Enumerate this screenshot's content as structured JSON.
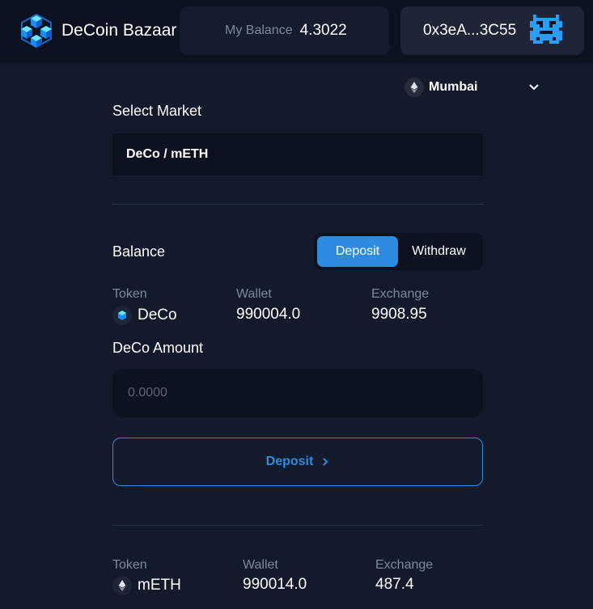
{
  "header": {
    "brand_name": "DeCoin Bazaar",
    "balance_label": "My Balance",
    "balance_value": "4.3022",
    "account_address": "0x3eA...3C55",
    "logo_icon": "hexagon-cubes-logo",
    "avatar_icon": "pixel-avatar-icon"
  },
  "network": {
    "label": "Mumbai",
    "icon": "ethereum-icon",
    "dropdown_icon": "chevron-down-icon"
  },
  "market": {
    "title": "Select Market",
    "selected": "DeCo / mETH"
  },
  "balance": {
    "title": "Balance",
    "toggle": {
      "deposit_label": "Deposit",
      "withdraw_label": "Withdraw",
      "active": "Deposit"
    },
    "columns": {
      "token": "Token",
      "wallet": "Wallet",
      "exchange": "Exchange"
    },
    "tokens": [
      {
        "name": "DeCo",
        "wallet": "990004.0",
        "exchange": "9908.95",
        "icon": "deco-token-icon"
      },
      {
        "name": "mETH",
        "wallet": "990014.0",
        "exchange": "487.4",
        "icon": "ethereum-icon"
      }
    ],
    "amount_label": "DeCo Amount",
    "amount_placeholder": "0.0000",
    "action_label": "Deposit"
  },
  "colors": {
    "background": "#121a2b",
    "header": "#0c1220",
    "accent": "#2d8ce0",
    "muted_text": "#7f8898"
  }
}
